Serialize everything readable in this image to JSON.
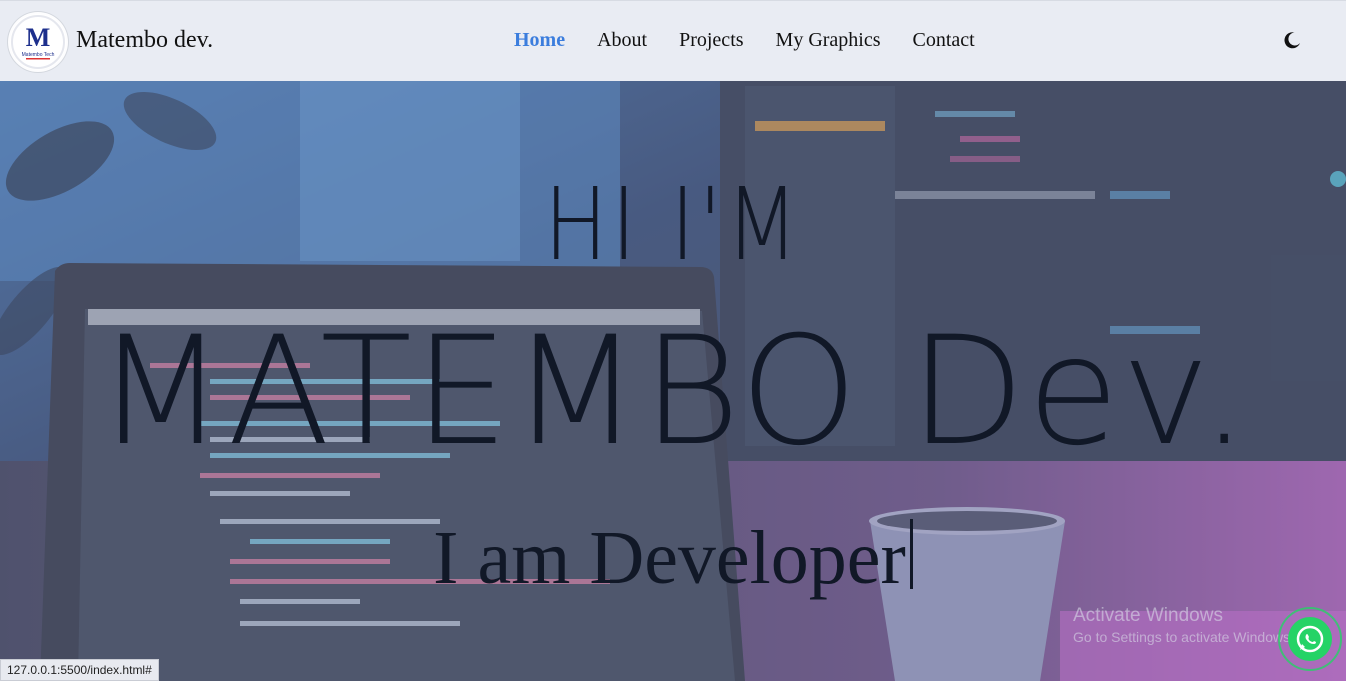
{
  "header": {
    "brand": "Matembo dev.",
    "logo_text": "M",
    "logo_sub": "Matembo Tech"
  },
  "nav": {
    "items": [
      {
        "label": "Home",
        "active": true
      },
      {
        "label": "About"
      },
      {
        "label": "Projects"
      },
      {
        "label": "My Graphics"
      },
      {
        "label": "Contact"
      }
    ],
    "theme_icon": "moon-icon"
  },
  "hero": {
    "greeting": "HI I'M",
    "name": "MATEMBO Dev.",
    "role_line": "I am Developer"
  },
  "watermark": {
    "line1": "Activate Windows",
    "line2": "Go to Settings to activate Windows."
  },
  "floating": {
    "whatsapp_icon": "whatsapp-icon"
  },
  "status_bar": {
    "url": "127.0.0.1:5500/index.html#"
  },
  "colors": {
    "nav_bg": "#e9ecf3",
    "active_link": "#3b7ddd",
    "whatsapp": "#25d366",
    "hero_text": "#111827"
  }
}
